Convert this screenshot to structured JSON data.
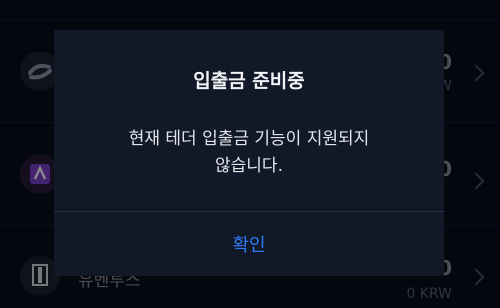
{
  "list": {
    "rows": [
      {
        "icon": "coin-logo-icon",
        "name": "",
        "amount": "0",
        "sub": "KRW"
      },
      {
        "icon": "coin-logo-icon",
        "name": "",
        "amount": "0",
        "sub": ""
      },
      {
        "icon": "juventus-logo-icon",
        "name": "유벤투스",
        "amount": "0",
        "sub": "0 KRW"
      }
    ]
  },
  "modal": {
    "title": "입출금 준비중",
    "message": "현재 테더 입출금 기능이 지원되지\n않습니다.",
    "confirm_label": "확인"
  },
  "colors": {
    "background": "#0a0e1a",
    "modal": "#111827",
    "accent": "#2f7df6"
  }
}
